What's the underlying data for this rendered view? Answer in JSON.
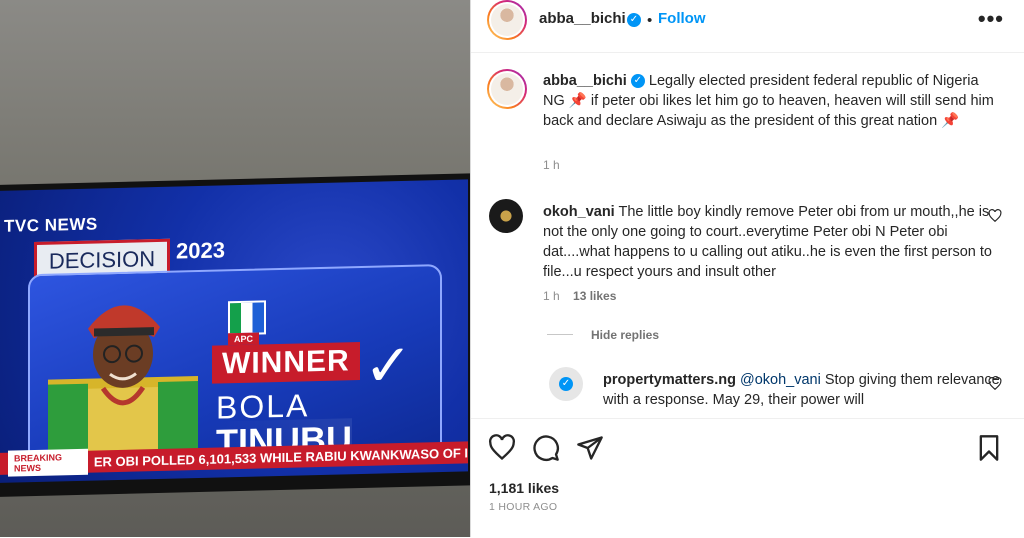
{
  "media": {
    "channel": "TVC NEWS",
    "decision_label": "DECISION",
    "year": "2023",
    "party": "APC",
    "winner_label": "WINNER",
    "first_name": "BOLA",
    "last_name": "TINUBU",
    "ticker_label": "BREAKING NEWS",
    "ticker_text": "ER OBI POLLED 6,101,533 WHILE RABIU KWANKWASO OF I"
  },
  "header": {
    "username": "abba__bichi",
    "follow_label": "Follow",
    "separator": "•",
    "more_label": "•••"
  },
  "caption": {
    "username": "abba__bichi",
    "text": "Legally elected president federal republic of Nigeria NG 📌 if peter obi likes let him go to heaven, heaven will still send him back and declare Asiwaju as the president of this great nation 📌",
    "age": "1 h"
  },
  "comments": [
    {
      "username": "okoh_vani",
      "text": "The little boy kindly remove Peter obi from ur mouth,,he is not the only one going to court..everytime Peter obi N Peter obi dat....what happens to u calling out atiku..he is even the first person to file...u respect yours and insult other",
      "age": "1 h",
      "likes": "13 likes"
    }
  ],
  "hide_replies_label": "Hide replies",
  "reply": {
    "username": "propertymatters.ng",
    "mention": "@okoh_vani",
    "text": "Stop giving them relevance with a response. May 29, their power will"
  },
  "footer": {
    "likes": "1,181 likes",
    "time": "1 HOUR AGO"
  },
  "colors": {
    "link_blue": "#0095f6",
    "tv_red": "#c71c2b",
    "tv_blue": "#1230a8"
  }
}
